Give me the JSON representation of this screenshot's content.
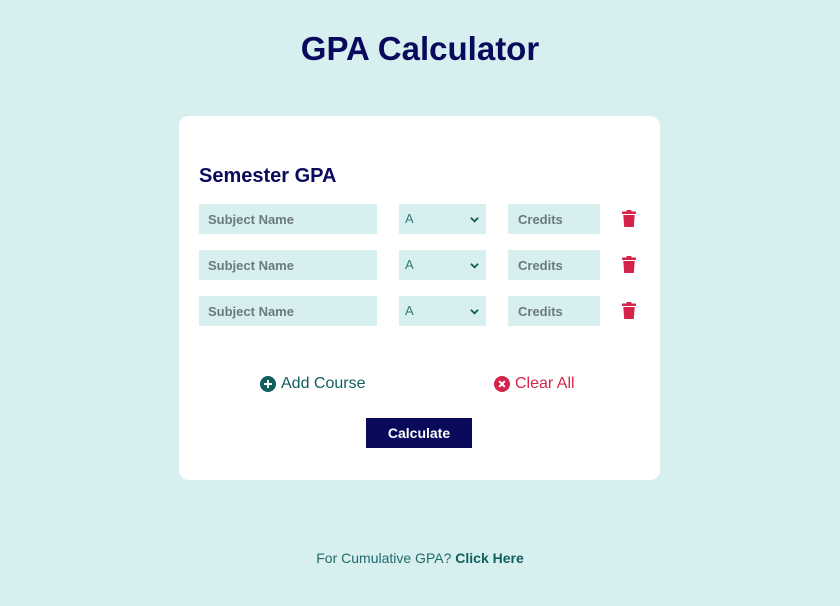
{
  "page": {
    "title": "GPA Calculator"
  },
  "card": {
    "title": "Semester GPA",
    "rows": [
      {
        "subject_placeholder": "Subject Name",
        "grade": "A",
        "credits_placeholder": "Credits"
      },
      {
        "subject_placeholder": "Subject Name",
        "grade": "A",
        "credits_placeholder": "Credits"
      },
      {
        "subject_placeholder": "Subject Name",
        "grade": "A",
        "credits_placeholder": "Credits"
      }
    ],
    "add_course_label": "Add Course",
    "clear_all_label": "Clear All",
    "calculate_label": "Calculate"
  },
  "footer": {
    "prefix": "For Cumulative GPA?",
    "link": "Click Here"
  },
  "colors": {
    "background": "#d8eff0",
    "navy": "#0a0a5c",
    "teal": "#0e5f5c",
    "red": "#d4244b"
  },
  "icons": {
    "delete": "trash-icon",
    "add": "plus-circle-icon",
    "clear": "x-circle-icon",
    "select": "chevron-down-icon"
  }
}
